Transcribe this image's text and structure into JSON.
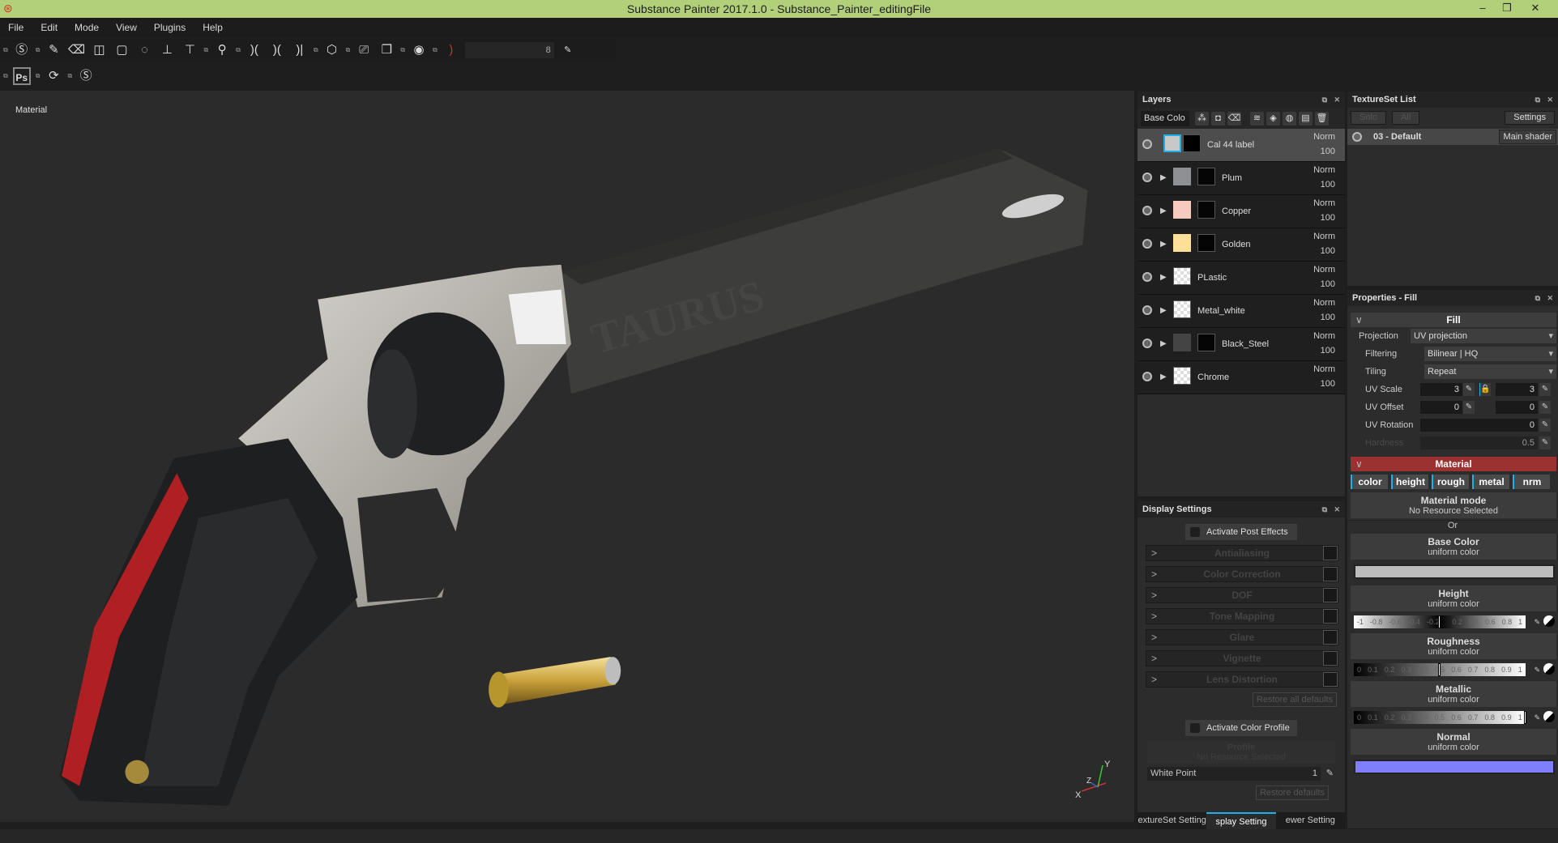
{
  "window": {
    "title": "Substance Painter 2017.1.0 - Substance_Painter_editingFile",
    "controls": [
      "–",
      "❐",
      "✕"
    ]
  },
  "menu": [
    "File",
    "Edit",
    "Mode",
    "View",
    "Plugins",
    "Help"
  ],
  "toolbar": {
    "brush_size": "8"
  },
  "viewport": {
    "label": "Material",
    "gizmo": {
      "x": "X",
      "y": "Y",
      "z": "Z"
    },
    "engraving": "TAURUS"
  },
  "layers": {
    "title": "Layers",
    "channel": "Base Colo",
    "items": [
      {
        "name": "Cal 44 label",
        "blend": "Norm",
        "opacity": "100",
        "color": "#c8c8c8",
        "selected": true
      },
      {
        "name": "Plum",
        "blend": "Norm",
        "opacity": "100",
        "color": "#8e9094"
      },
      {
        "name": "Copper",
        "blend": "Norm",
        "opacity": "100",
        "color": "#f6cbbd"
      },
      {
        "name": "Golden",
        "blend": "Norm",
        "opacity": "100",
        "color": "#fddf9a"
      },
      {
        "name": "PLastic",
        "blend": "Norm",
        "opacity": "100"
      },
      {
        "name": "Metal_white",
        "blend": "Norm",
        "opacity": "100"
      },
      {
        "name": "Black_Steel",
        "blend": "Norm",
        "opacity": "100",
        "color": "#444444"
      },
      {
        "name": "Chrome",
        "blend": "Norm",
        "opacity": "100"
      }
    ]
  },
  "display": {
    "title": "Display Settings",
    "post_effects": "Activate Post Effects",
    "effects": [
      "Antialiasing",
      "Color Correction",
      "DOF",
      "Tone Mapping",
      "Glare",
      "Vignette",
      "Lens Distortion"
    ],
    "restore_all": "Restore all defaults",
    "color_profile": "Activate Color Profile",
    "profile": "Profile",
    "profile_value": "No Resource Selected",
    "white_point_label": "White Point",
    "white_point": "1",
    "restore": "Restore defaults"
  },
  "bottom_tabs": [
    "extureSet Setting",
    "splay Setting",
    "ewer Setting"
  ],
  "textureset": {
    "title": "TextureSet List",
    "solo": "Solo",
    "all": "All",
    "settings": "Settings",
    "set_name": "03 - Default",
    "shader": "Main shader"
  },
  "properties": {
    "title": "Properties - Fill",
    "fill": "Fill",
    "projection_label": "Projection",
    "projection": "UV projection",
    "filtering_label": "Filtering",
    "filtering": "Bilinear | HQ",
    "tiling_label": "Tiling",
    "tiling": "Repeat",
    "uv_scale_label": "UV Scale",
    "uv_scale": [
      "3",
      "3"
    ],
    "uv_offset_label": "UV Offset",
    "uv_offset": [
      "0",
      "0"
    ],
    "uv_rotation_label": "UV Rotation",
    "uv_rotation": "0",
    "hardness_label": "Hardness",
    "hardness": "0.5",
    "material": "Material",
    "channels": [
      "color",
      "height",
      "rough",
      "metal",
      "nrm"
    ],
    "material_mode": "Material mode",
    "no_resource": "No Resource Selected",
    "or": "Or",
    "base_color": {
      "label": "Base Color",
      "type": "uniform color",
      "value": "#bdbdbd"
    },
    "height": {
      "label": "Height",
      "type": "uniform color",
      "value": 0,
      "ticks": [
        "-1",
        "-0.8",
        "-0.6",
        "-0.4",
        "-0.2",
        "",
        "0.2",
        "0.4",
        "0.6",
        "0.8",
        "1"
      ]
    },
    "roughness": {
      "label": "Roughness",
      "type": "uniform color",
      "value": 0.5,
      "ticks": [
        "0",
        "0.1",
        "0.2",
        "0.3",
        "0.4",
        "0.5",
        "0.6",
        "0.7",
        "0.8",
        "0.9",
        "1"
      ]
    },
    "metallic": {
      "label": "Metallic",
      "type": "uniform color",
      "value": 1,
      "ticks": [
        "0",
        "0.1",
        "0.2",
        "0.3",
        "0.4",
        "0.5",
        "0.6",
        "0.7",
        "0.8",
        "0.9",
        "1"
      ]
    },
    "normal": {
      "label": "Normal",
      "type": "uniform color",
      "value": "#7f7ffb"
    }
  }
}
